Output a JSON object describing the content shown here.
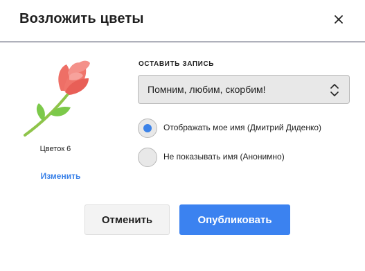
{
  "dialog": {
    "title": "Возложить цветы",
    "close_icon": "close-icon"
  },
  "flower": {
    "icon": "rose-icon",
    "caption": "Цветок 6",
    "change_link": "Изменить",
    "colors": {
      "petal": "#ee6f66",
      "petal_light": "#f4918a",
      "leaf": "#7cc94a",
      "stem": "#8fc44a"
    }
  },
  "record": {
    "section_label": "ОСТАВИТЬ ЗАПИСЬ",
    "selected_message": "Помним, любим, скорбим!",
    "chevron_icon": "chevron-up-down-icon"
  },
  "name_options": [
    {
      "label": "Отображать мое имя (Дмитрий Диденко)",
      "selected": true
    },
    {
      "label": "Не показывать имя (Анонимно)",
      "selected": false
    }
  ],
  "actions": {
    "cancel_label": "Отменить",
    "publish_label": "Опубликовать"
  },
  "colors": {
    "accent": "#3b82f0",
    "link": "#3b82e8",
    "divider": "#2b2f4a"
  }
}
